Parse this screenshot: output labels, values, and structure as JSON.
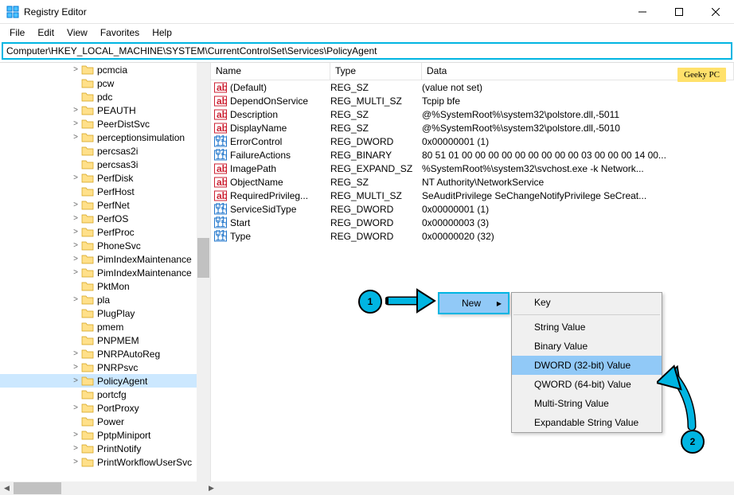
{
  "window": {
    "title": "Registry Editor"
  },
  "menu": {
    "file": "File",
    "edit": "Edit",
    "view": "View",
    "favorites": "Favorites",
    "help": "Help"
  },
  "address": "Computer\\HKEY_LOCAL_MACHINE\\SYSTEM\\CurrentControlSet\\Services\\PolicyAgent",
  "tree": {
    "items": [
      {
        "label": "pcmcia",
        "exp": ">"
      },
      {
        "label": "pcw",
        "exp": ""
      },
      {
        "label": "pdc",
        "exp": ""
      },
      {
        "label": "PEAUTH",
        "exp": ">"
      },
      {
        "label": "PeerDistSvc",
        "exp": ">"
      },
      {
        "label": "perceptionsimulation",
        "exp": ">"
      },
      {
        "label": "percsas2i",
        "exp": ""
      },
      {
        "label": "percsas3i",
        "exp": ""
      },
      {
        "label": "PerfDisk",
        "exp": ">"
      },
      {
        "label": "PerfHost",
        "exp": ""
      },
      {
        "label": "PerfNet",
        "exp": ">"
      },
      {
        "label": "PerfOS",
        "exp": ">"
      },
      {
        "label": "PerfProc",
        "exp": ">"
      },
      {
        "label": "PhoneSvc",
        "exp": ">"
      },
      {
        "label": "PimIndexMaintenance",
        "exp": ">"
      },
      {
        "label": "PimIndexMaintenance",
        "exp": ">"
      },
      {
        "label": "PktMon",
        "exp": ""
      },
      {
        "label": "pla",
        "exp": ">"
      },
      {
        "label": "PlugPlay",
        "exp": ""
      },
      {
        "label": "pmem",
        "exp": ""
      },
      {
        "label": "PNPMEM",
        "exp": ""
      },
      {
        "label": "PNRPAutoReg",
        "exp": ">"
      },
      {
        "label": "PNRPsvc",
        "exp": ">"
      },
      {
        "label": "PolicyAgent",
        "exp": ">",
        "selected": true
      },
      {
        "label": "portcfg",
        "exp": ""
      },
      {
        "label": "PortProxy",
        "exp": ">"
      },
      {
        "label": "Power",
        "exp": ""
      },
      {
        "label": "PptpMiniport",
        "exp": ">"
      },
      {
        "label": "PrintNotify",
        "exp": ">"
      },
      {
        "label": "PrintWorkflowUserSvc",
        "exp": ">"
      }
    ]
  },
  "columns": {
    "name": "Name",
    "type": "Type",
    "data": "Data"
  },
  "values": [
    {
      "icon": "ab",
      "name": "(Default)",
      "type": "REG_SZ",
      "data": "(value not set)"
    },
    {
      "icon": "ab",
      "name": "DependOnService",
      "type": "REG_MULTI_SZ",
      "data": "Tcpip bfe"
    },
    {
      "icon": "ab",
      "name": "Description",
      "type": "REG_SZ",
      "data": "@%SystemRoot%\\system32\\polstore.dll,-5011"
    },
    {
      "icon": "ab",
      "name": "DisplayName",
      "type": "REG_SZ",
      "data": "@%SystemRoot%\\system32\\polstore.dll,-5010"
    },
    {
      "icon": "bin",
      "name": "ErrorControl",
      "type": "REG_DWORD",
      "data": "0x00000001 (1)"
    },
    {
      "icon": "bin",
      "name": "FailureActions",
      "type": "REG_BINARY",
      "data": "80 51 01 00 00 00 00 00 00 00 00 00 03 00 00 00 14 00..."
    },
    {
      "icon": "ab",
      "name": "ImagePath",
      "type": "REG_EXPAND_SZ",
      "data": "%SystemRoot%\\system32\\svchost.exe -k Network..."
    },
    {
      "icon": "ab",
      "name": "ObjectName",
      "type": "REG_SZ",
      "data": "NT Authority\\NetworkService"
    },
    {
      "icon": "ab",
      "name": "RequiredPrivileg...",
      "type": "REG_MULTI_SZ",
      "data": "SeAuditPrivilege SeChangeNotifyPrivilege SeCreat..."
    },
    {
      "icon": "bin",
      "name": "ServiceSidType",
      "type": "REG_DWORD",
      "data": "0x00000001 (1)"
    },
    {
      "icon": "bin",
      "name": "Start",
      "type": "REG_DWORD",
      "data": "0x00000003 (3)"
    },
    {
      "icon": "bin",
      "name": "Type",
      "type": "REG_DWORD",
      "data": "0x00000020 (32)"
    }
  ],
  "ctx": {
    "new": "New",
    "sub": {
      "key": "Key",
      "string": "String Value",
      "binary": "Binary Value",
      "dword": "DWORD (32-bit) Value",
      "qword": "QWORD (64-bit) Value",
      "multi": "Multi-String Value",
      "expand": "Expandable String Value"
    }
  },
  "annot": {
    "one": "1",
    "two": "2"
  },
  "watermark": "Geeky PC"
}
